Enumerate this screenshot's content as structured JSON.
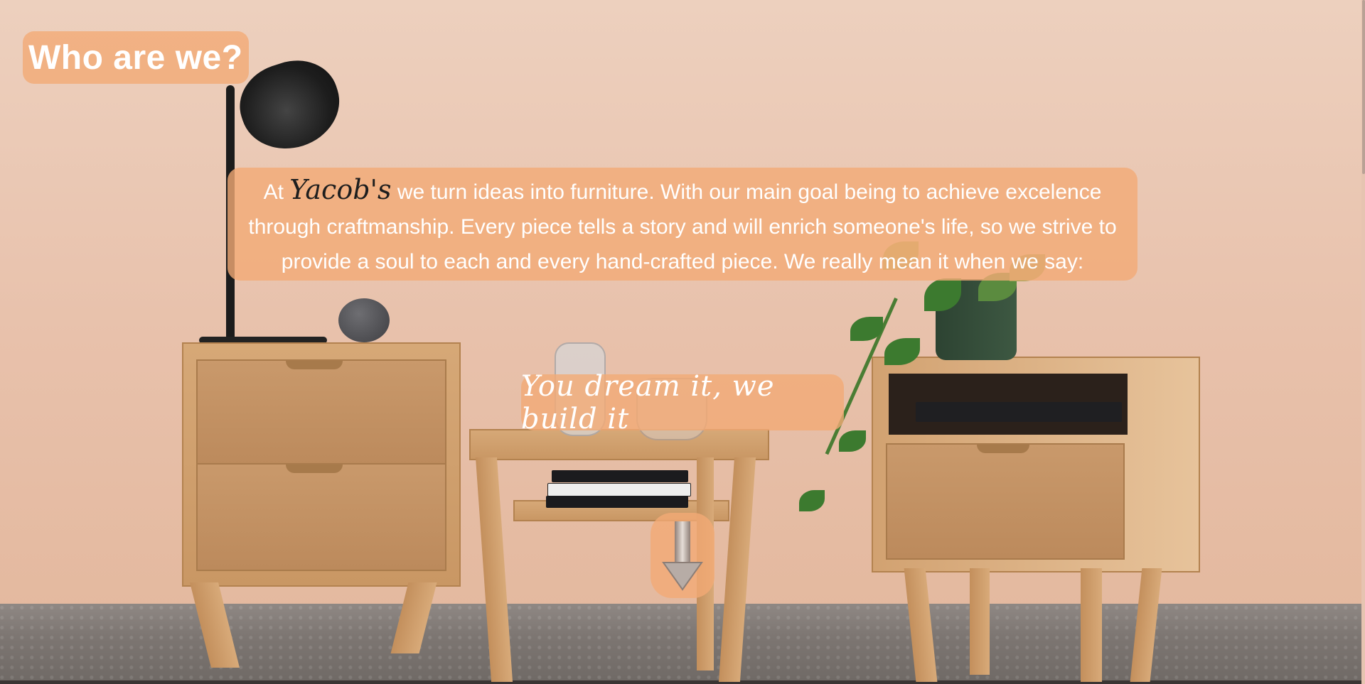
{
  "header": {
    "title": "Who are we?"
  },
  "intro": {
    "prefix": "At ",
    "brand": "Yacob's",
    "body": " we turn ideas into furniture. With our main goal being to achieve excelence through craftmanship. Every piece tells a story and will enrich someone's life, so we strive to provide a soul to each and every hand-crafted piece. We really mean it when we say:"
  },
  "slogan": "You dream it, we build it",
  "scroll_icon": "arrow-down-icon",
  "colors": {
    "accent": "#f3aa76",
    "text": "#ffffff",
    "brand_text": "#1e1e1e"
  }
}
